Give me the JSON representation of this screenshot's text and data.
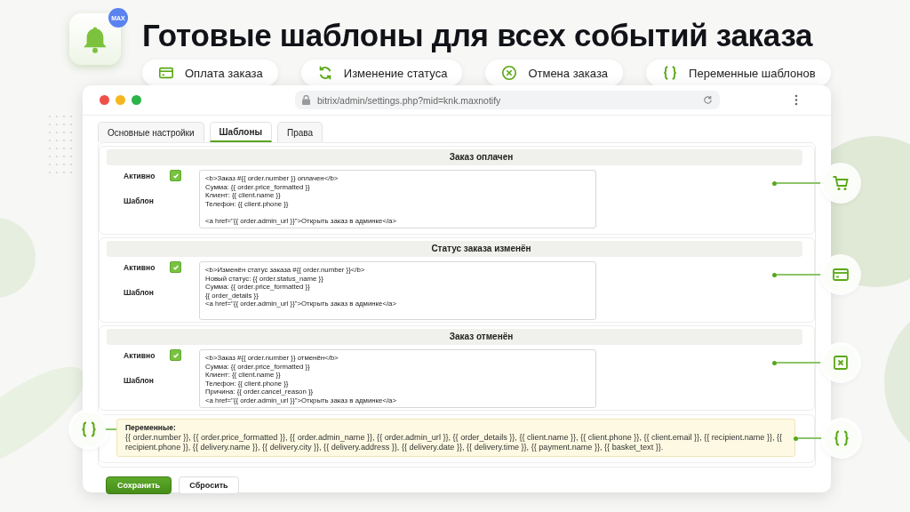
{
  "app_icon": {
    "badge": "MAX"
  },
  "headline": "Готовые шаблоны для всех событий заказа",
  "features": [
    {
      "kind": "card",
      "label": "Оплата заказа"
    },
    {
      "kind": "refresh",
      "label": "Изменение статуса"
    },
    {
      "kind": "cancel",
      "label": "Отмена заказа"
    },
    {
      "kind": "braces",
      "label": "Переменные шаблонов"
    }
  ],
  "browser": {
    "url": "bitrix/admin/settings.php?mid=knk.maxnotify",
    "tabs": [
      {
        "label": "Основные настройки",
        "selected": false
      },
      {
        "label": "Шаблоны",
        "selected": true
      },
      {
        "label": "Права",
        "selected": false
      }
    ],
    "sections": [
      {
        "title": "Заказ оплачен",
        "active_label": "Активно",
        "active": true,
        "template_label": "Шаблон",
        "template": "<b>Заказ #{{ order.number }} оплачен</b>\nСумма: {{ order.price_formatted }}\nКлиент: {{ client.name }}\nТелефон: {{ client.phone }}\n\n<a href=\"{{ order.admin_url }}\">Открыть заказ в админке</a>",
        "kind": "cart"
      },
      {
        "title": "Статус заказа изменён",
        "active_label": "Активно",
        "active": true,
        "template_label": "Шаблон",
        "template": "<b>Изменён статус заказа #{{ order.number }}</b>\nНовый статус: {{ order.status_name }}\nСумма: {{ order.price_formatted }}\n{{ order_details }}\n<a href=\"{{ order.admin_url }}\">Открыть заказ в админке</a>",
        "kind": "card"
      },
      {
        "title": "Заказ отменён",
        "active_label": "Активно",
        "active": true,
        "template_label": "Шаблон",
        "template": "<b>Заказ #{{ order.number }} отменён</b>\nСумма: {{ order.price_formatted }}\nКлиент: {{ client.name }}\nТелефон: {{ client.phone }}\nПричина: {{ order.cancel_reason }}\n<a href=\"{{ order.admin_url }}\">Открыть заказ в админке</a>",
        "kind": "xbox"
      }
    ],
    "variables": {
      "title": "Переменные:",
      "text": "{{ order.number }}, {{ order.price_formatted }}, {{ order.admin_name }}, {{ order.admin_url }}, {{ order_details }}, {{ client.name }}, {{ client.phone }}, {{ client.email }}, {{ recipient.name }}, {{ recipient.phone }}, {{ delivery.name }}, {{ delivery.city }}, {{ delivery.address }}, {{ delivery.date }}, {{ delivery.time }}, {{ payment.name }}, {{ basket_text }}."
    },
    "buttons": [
      {
        "label": "Сохранить",
        "kind": "primary"
      },
      {
        "label": "Сбросить",
        "kind": "secondary"
      }
    ]
  }
}
